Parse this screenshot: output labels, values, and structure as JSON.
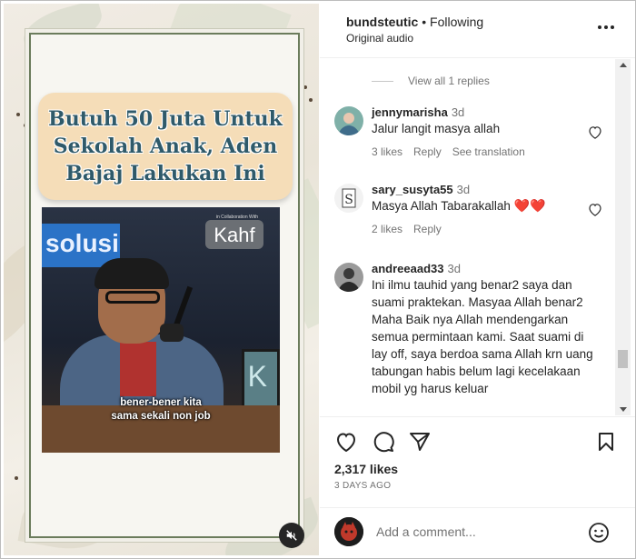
{
  "post": {
    "headline": "Butuh 50 Juta Untuk Sekolah Anak, Aden Bajaj Lakukan Ini",
    "video_caption_line1": "bener-bener kita",
    "video_caption_line2": "sama sekali non job",
    "banner_text": "solusi",
    "sponsor_small": "in Collaboration With",
    "sponsor": "Kahf",
    "screen_letter": "K",
    "mute_icon": "speaker-muted-icon"
  },
  "header": {
    "username": "bundsteutic",
    "separator": "•",
    "follow_status": "Following",
    "audio": "Original audio",
    "more_icon": "more-horizontal-icon"
  },
  "comments": {
    "view_replies": "View all 1 replies",
    "items": [
      {
        "username": "jennymarisha",
        "time": "3d",
        "text": "Jalur langit masya allah",
        "likes": "3 likes",
        "reply": "Reply",
        "translate": "See translation"
      },
      {
        "username": "sary_susyta55",
        "time": "3d",
        "text": "Masya Allah Tabarakallah",
        "emoji": "❤️❤️",
        "likes": "2 likes",
        "reply": "Reply"
      },
      {
        "username": "andreeaad33",
        "time": "3d",
        "text": "Ini ilmu tauhid yang benar2 saya dan suami praktekan. Masyaa Allah benar2 Maha Baik nya Allah mendengarkan semua permintaan kami. Saat suami di lay off, saya berdoa sama Allah krn uang tabungan habis belum lagi kecelakaan mobil yg harus keluar"
      }
    ]
  },
  "actions": {
    "likes": "2,317 likes",
    "date": "3 DAYS AGO"
  },
  "composer": {
    "placeholder": "Add a comment..."
  },
  "colors": {
    "text": "#262626",
    "muted": "#737373",
    "headline_bg": "#f5ddb8",
    "headline_text": "#2f5a6a",
    "heart_red": "#e0245e"
  }
}
